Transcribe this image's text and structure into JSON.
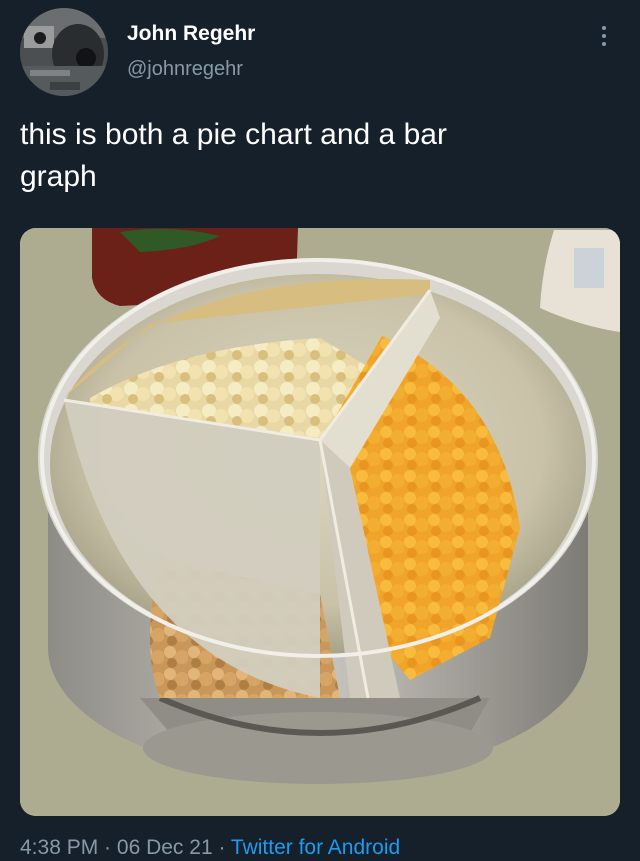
{
  "tweet": {
    "author_name": "John Regehr",
    "author_handle": "@johnregehr",
    "text": "this is both a pie chart and a bar\ngraph",
    "time": "4:38 PM",
    "separator": " · ",
    "date": "06 Dec 21",
    "source": "Twitter for Android"
  },
  "icons": {
    "more": "more-vertical-icon",
    "avatar": "avatar-image"
  },
  "colors": {
    "background": "#15202b",
    "text_primary": "#ffffff",
    "text_secondary": "#8899a6",
    "link": "#1d9bf0"
  }
}
